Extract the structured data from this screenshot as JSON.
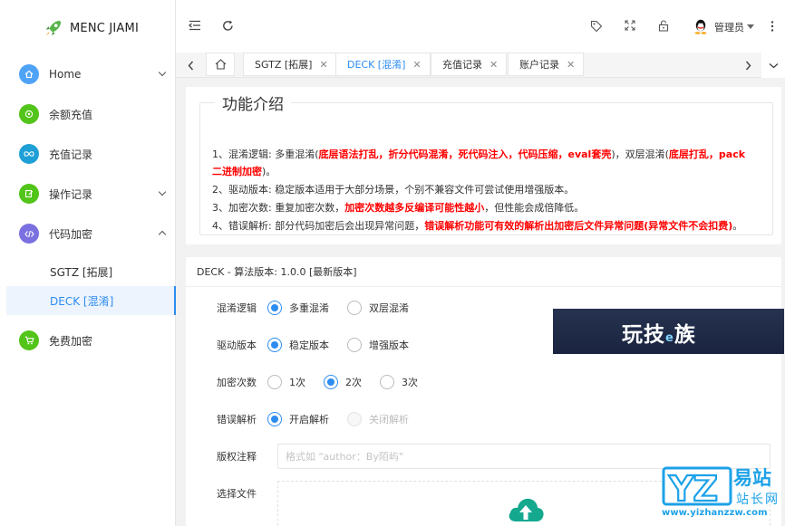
{
  "app": {
    "name": "MENC JIAMI"
  },
  "sidebar": {
    "items": [
      {
        "label": "Home",
        "icon": "home-icon",
        "color": "#4fa3f7",
        "glyph": "⌂",
        "expandable": true
      },
      {
        "label": "余额充值",
        "icon": "coin-icon",
        "color": "#52c41a",
        "glyph": "☺",
        "expandable": false
      },
      {
        "label": "充值记录",
        "icon": "infinity-icon",
        "color": "#1e9fd6",
        "glyph": "∞",
        "expandable": false
      },
      {
        "label": "操作记录",
        "icon": "edit-icon",
        "color": "#52c41a",
        "glyph": "✎",
        "expandable": true
      },
      {
        "label": "代码加密",
        "icon": "code-icon",
        "color": "#7a70e0",
        "glyph": "‹›",
        "expandable": true,
        "expanded": true
      },
      {
        "label": "免费加密",
        "icon": "cart-icon",
        "color": "#52c41a",
        "glyph": "⊔",
        "expandable": false
      }
    ],
    "sub_items": [
      {
        "label": "SGTZ [拓展]"
      },
      {
        "label": "DECK [混淆]",
        "active": true
      }
    ]
  },
  "topbar": {
    "icons": [
      "collapse-icon",
      "refresh-icon",
      "tag-icon",
      "fullscreen-icon",
      "lock-icon",
      "more-icon"
    ],
    "user_name": "管理员"
  },
  "tabs": [
    {
      "label": "SGTZ [拓展]"
    },
    {
      "label": "DECK [混淆]",
      "active": true
    },
    {
      "label": "充值记录"
    },
    {
      "label": "账户记录"
    }
  ],
  "intro": {
    "legend": "功能介绍",
    "line1_a": "1、混淆逻辑: 多重混淆(",
    "line1_red1": "底层语法打乱，折分代码混淆，死代码注入，代码压缩，eval套壳",
    "line1_b": ")，双层混淆(",
    "line1_red2": "底层打乱，pack二进制加密",
    "line1_c": ")。",
    "line2": "2、驱动版本: 稳定版本适用于大部分场景，个别不兼容文件可尝试使用增强版本。",
    "line3_a": "3、加密次数: 重复加密次数，",
    "line3_red": "加密次数越多反编译可能性越小",
    "line3_b": "，但性能会成倍降低。",
    "line4_a": "4、错误解析: 部分代码加密后会出现异常问题，",
    "line4_red": "错误解析功能可有效的解析出加密后文件异常问题(异常文件不会扣费)",
    "line4_b": "。"
  },
  "form": {
    "title": "DECK - 算法版本: 1.0.0 [最新版本]",
    "fields": [
      {
        "label": "混淆逻辑",
        "options": [
          {
            "label": "多重混淆",
            "checked": true
          },
          {
            "label": "双层混淆",
            "checked": false
          }
        ]
      },
      {
        "label": "驱动版本",
        "options": [
          {
            "label": "稳定版本",
            "checked": true
          },
          {
            "label": "增强版本",
            "checked": false
          }
        ]
      },
      {
        "label": "加密次数",
        "options": [
          {
            "label": "1次",
            "checked": false
          },
          {
            "label": "2次",
            "checked": true
          },
          {
            "label": "3次",
            "checked": false
          }
        ]
      },
      {
        "label": "错误解析",
        "options": [
          {
            "label": "开启解析",
            "checked": true
          },
          {
            "label": "关闭解析",
            "checked": false,
            "disabled": true
          }
        ]
      }
    ],
    "copyright_label": "版权注释",
    "copyright_placeholder": "格式如 \"author：By陌屿\"",
    "file_label": "选择文件"
  },
  "banner": {
    "text_a": "玩技",
    "text_e": "e",
    "text_b": "族"
  },
  "watermark": {
    "big": "易站",
    "small": "站长网",
    "letters": "YZ",
    "url": "www.yizhanzzw.com"
  },
  "colors": {
    "accent": "#2d8cf0",
    "red": "#ff0000"
  }
}
